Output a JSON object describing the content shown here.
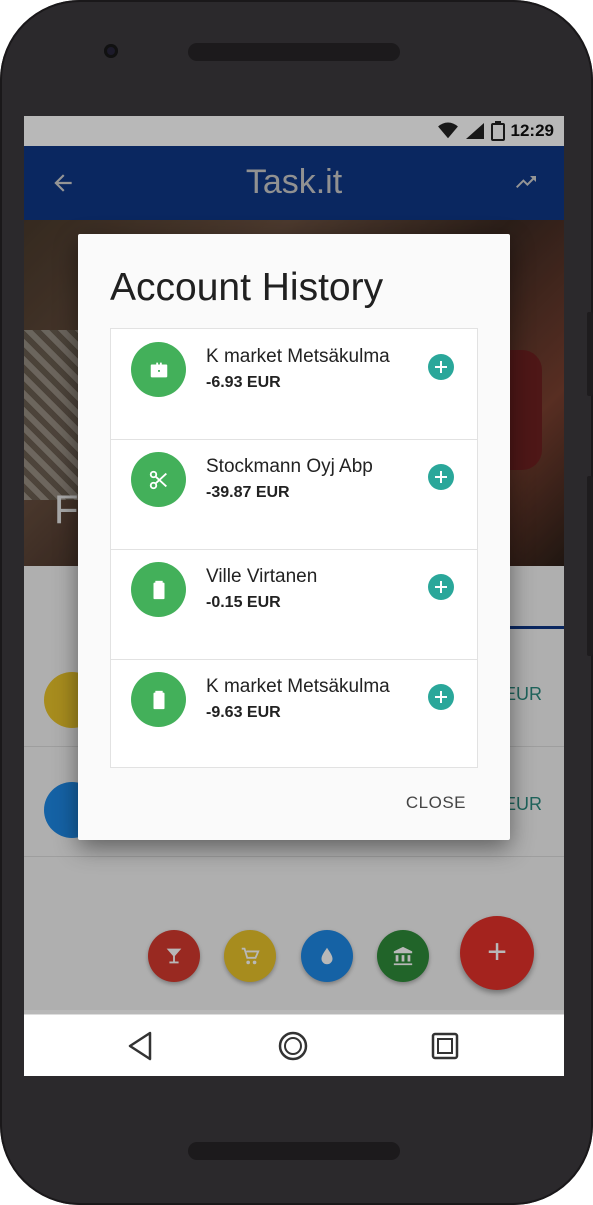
{
  "status": {
    "time": "12:29"
  },
  "appbar": {
    "title": "Task.it",
    "back_icon": "arrow-back-icon",
    "action_icon": "trending-up-icon"
  },
  "hero": {
    "left_text": "F"
  },
  "background_rows": [
    {
      "icon": "cart-icon",
      "color": "#e8c22a",
      "amount_suffix": "EUR"
    },
    {
      "icon": "water-drop-icon",
      "color": "#1e88e5",
      "amount_suffix": "EUR"
    }
  ],
  "fab_menu": [
    {
      "icon": "cocktail-icon",
      "color": "#d53a2f"
    },
    {
      "icon": "cart-icon",
      "color": "#e8c22a"
    },
    {
      "icon": "water-drop-icon",
      "color": "#1e88e5"
    },
    {
      "icon": "bank-icon",
      "color": "#2e8b3a"
    }
  ],
  "main_fab": {
    "label": "+",
    "color": "#e4312a"
  },
  "dialog": {
    "title": "Account History",
    "close_label": "CLOSE",
    "items": [
      {
        "name": "K market Metsäkulma",
        "amount": "-6.93 EUR",
        "icon": "briefcase-icon"
      },
      {
        "name": "Stockmann Oyj Abp",
        "amount": "-39.87 EUR",
        "icon": "scissors-icon"
      },
      {
        "name": "Ville Virtanen",
        "amount": "-0.15 EUR",
        "icon": "battery-icon"
      },
      {
        "name": "K market Metsäkulma",
        "amount": "-9.63 EUR",
        "icon": "battery-icon"
      }
    ]
  },
  "colors": {
    "appbar": "#0f3685",
    "accent_green": "#43b05a",
    "add_teal": "#2aa79a"
  }
}
